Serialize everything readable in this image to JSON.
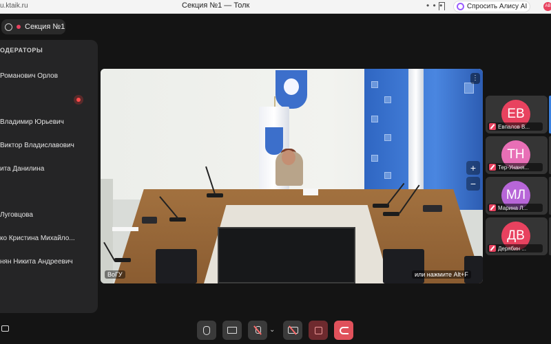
{
  "browser": {
    "url": "u.ktaik.ru",
    "tab_title": "Секция №1 — Толк",
    "menu_dots": "• • •",
    "alice_label": "Спросить Алису AI",
    "badge": "AB"
  },
  "room": {
    "name": "Секция №1"
  },
  "panel": {
    "header": "ОДЕРАТОРЫ",
    "participants": [
      "Романович Орлов",
      "Владимир Юрьевич",
      "Виктор Владиславович",
      "ита Данилина",
      "Луговцова",
      "ко Кристина Михайло...",
      "нян Никита Андреевич"
    ]
  },
  "main_video": {
    "label": "ВоГУ",
    "hint": "или нажмите Alt+F",
    "menu": "⋮",
    "zoom_in": "+",
    "zoom_out": "−"
  },
  "tiles": [
    {
      "initials": "ЕВ",
      "name": "Евпалов В...",
      "color": "#e8425f"
    },
    {
      "initials": "ТН",
      "name": "Тер-Унаня...",
      "color": "#e86fb6"
    },
    {
      "initials": "МЛ",
      "name": "Марина Л...",
      "color": "#b766d8"
    },
    {
      "initials": "ДВ",
      "name": "Дерябин ...",
      "color": "#e8425f"
    }
  ]
}
